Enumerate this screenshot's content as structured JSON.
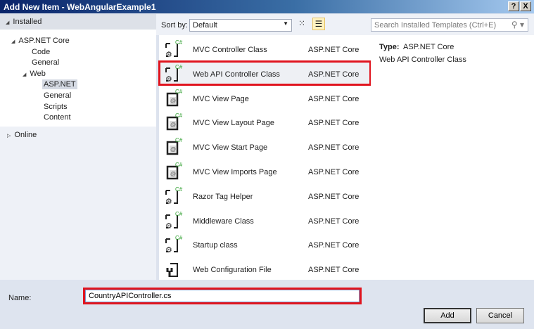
{
  "window": {
    "title": "Add New Item - WebAngularExample1",
    "help": "?",
    "close": "X"
  },
  "sidebar": {
    "installed": "Installed",
    "tree": [
      {
        "label": "ASP.NET Core"
      },
      {
        "label": "Code"
      },
      {
        "label": "General"
      },
      {
        "label": "Web"
      },
      {
        "label": "ASP.NET"
      },
      {
        "label": "General"
      },
      {
        "label": "Scripts"
      },
      {
        "label": "Content"
      }
    ],
    "online": "Online"
  },
  "toolbar": {
    "sort_label": "Sort by:",
    "sort_value": "Default",
    "search_placeholder": "Search Installed Templates (Ctrl+E)"
  },
  "templates": [
    {
      "name": "MVC Controller Class",
      "category": "ASP.NET Core",
      "icon": "controller"
    },
    {
      "name": "Web API Controller Class",
      "category": "ASP.NET Core",
      "icon": "controller"
    },
    {
      "name": "MVC View Page",
      "category": "ASP.NET Core",
      "icon": "view"
    },
    {
      "name": "MVC View Layout Page",
      "category": "ASP.NET Core",
      "icon": "view"
    },
    {
      "name": "MVC View Start Page",
      "category": "ASP.NET Core",
      "icon": "view"
    },
    {
      "name": "MVC View Imports Page",
      "category": "ASP.NET Core",
      "icon": "view"
    },
    {
      "name": "Razor Tag Helper",
      "category": "ASP.NET Core",
      "icon": "controller"
    },
    {
      "name": "Middleware Class",
      "category": "ASP.NET Core",
      "icon": "controller"
    },
    {
      "name": "Startup class",
      "category": "ASP.NET Core",
      "icon": "controller"
    },
    {
      "name": "Web Configuration File",
      "category": "ASP.NET Core",
      "icon": "config"
    }
  ],
  "details": {
    "type_label": "Type:",
    "type_value": "ASP.NET Core",
    "description": "Web API Controller Class"
  },
  "footer": {
    "name_label": "Name:",
    "name_value": "CountryAPIController.cs",
    "add": "Add",
    "cancel": "Cancel"
  }
}
